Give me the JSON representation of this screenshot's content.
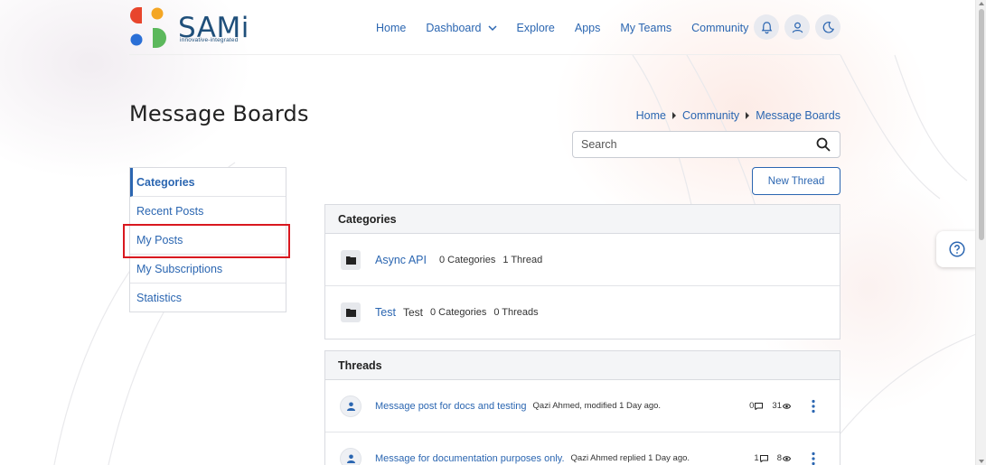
{
  "brand": {
    "name": "SAMi",
    "tagline": "innovative-integrated"
  },
  "nav": {
    "items": [
      {
        "label": "Home",
        "has_dropdown": false
      },
      {
        "label": "Dashboard",
        "has_dropdown": true
      },
      {
        "label": "Explore",
        "has_dropdown": false
      },
      {
        "label": "Apps",
        "has_dropdown": false
      },
      {
        "label": "My Teams",
        "has_dropdown": false
      },
      {
        "label": "Community",
        "has_dropdown": true
      }
    ],
    "icons": [
      "bell-icon",
      "user-icon",
      "moon-icon"
    ]
  },
  "page": {
    "title": "Message Boards"
  },
  "breadcrumb": [
    "Home",
    "Community",
    "Message Boards"
  ],
  "search": {
    "placeholder": "Search",
    "value": ""
  },
  "sidebar": {
    "items": [
      {
        "label": "Categories",
        "active": true
      },
      {
        "label": "Recent Posts",
        "active": false
      },
      {
        "label": "My Posts",
        "active": false,
        "highlighted": true
      },
      {
        "label": "My Subscriptions",
        "active": false
      },
      {
        "label": "Statistics",
        "active": false
      }
    ]
  },
  "actions": {
    "new_thread": "New Thread"
  },
  "categories_panel": {
    "heading": "Categories",
    "rows": [
      {
        "name": "Async API",
        "description": "",
        "categories": "0 Categories",
        "threads": "1 Thread"
      },
      {
        "name": "Test",
        "description": "Test",
        "categories": "0 Categories",
        "threads": "0 Threads"
      }
    ]
  },
  "threads_panel": {
    "heading": "Threads",
    "rows": [
      {
        "title": "Message post for docs and testing",
        "meta": "Qazi Ahmed, modified 1 Day ago.",
        "replies": "0",
        "views": "31"
      },
      {
        "title": "Message for documentation purposes only.",
        "meta": "Qazi Ahmed replied 1 Day ago.",
        "replies": "1",
        "views": "8"
      }
    ]
  },
  "colors": {
    "link": "#2b66b1",
    "highlight": "#d9181f",
    "brand_text": "#1f4f7a",
    "logo_red": "#e8452c",
    "logo_orange": "#f4a624",
    "logo_blue": "#2a6fd6",
    "logo_green": "#5cb85c"
  }
}
